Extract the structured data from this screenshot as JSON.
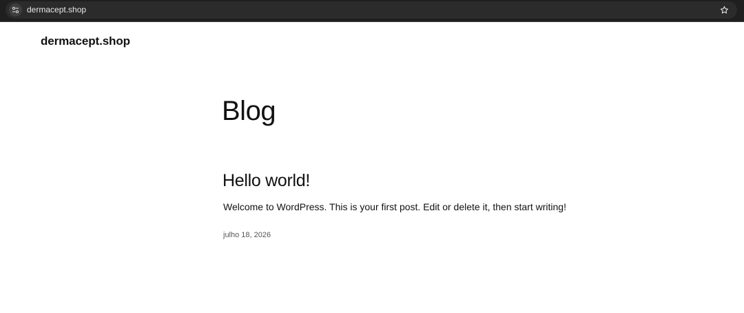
{
  "browser": {
    "url": "dermacept.shop",
    "site_info_icon": "tune-icon",
    "bookmark_icon": "star-outline-icon"
  },
  "site": {
    "title": "dermacept.shop"
  },
  "page": {
    "title": "Blog"
  },
  "posts": [
    {
      "title": "Hello world!",
      "excerpt": "Welcome to WordPress. This is your first post. Edit or delete it, then start writing!",
      "date": "julho 18, 2026"
    }
  ],
  "colors": {
    "chrome_bg": "#1f1f1f",
    "url_pill_bg": "#2b2b2b",
    "page_bg": "#ffffff",
    "text": "#111111",
    "muted_text": "#555555"
  }
}
